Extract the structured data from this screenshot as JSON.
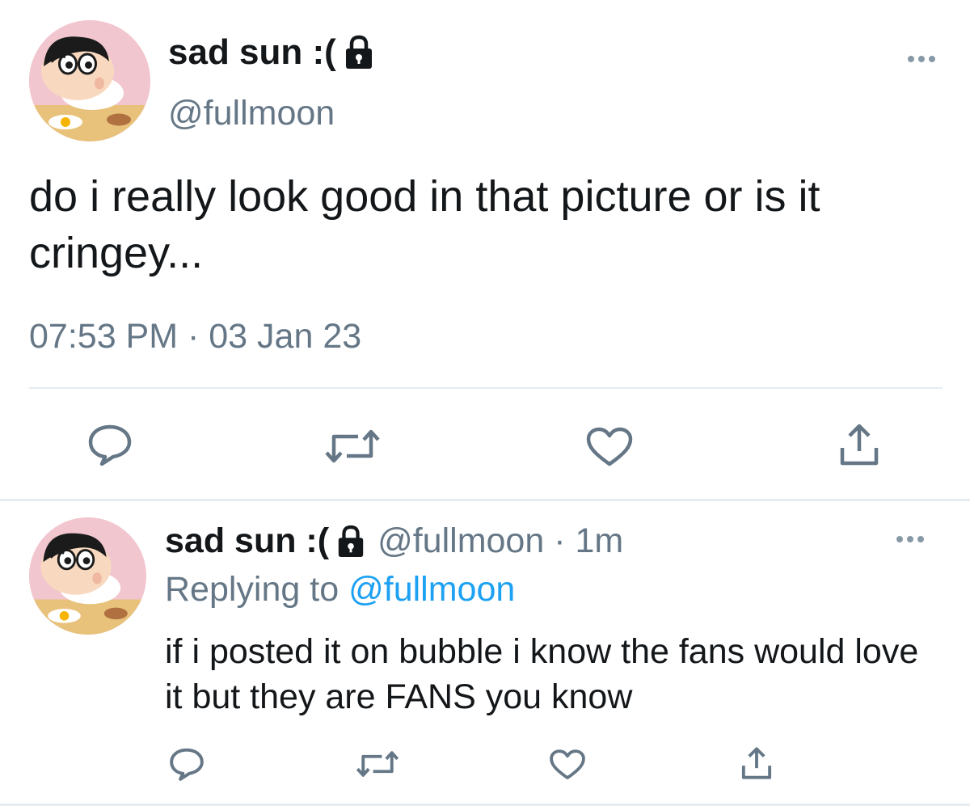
{
  "main_tweet": {
    "display_name": "sad sun :(",
    "handle": "@fullmoon",
    "text": "do i really look good in that picture or is it cringey...",
    "timestamp": "07:53 PM · 03 Jan 23",
    "icons": {
      "lock": "lock-icon",
      "more": "more-icon",
      "reply": "reply-icon",
      "retweet": "retweet-icon",
      "like": "like-icon",
      "share": "share-icon"
    }
  },
  "reply_tweet": {
    "display_name": "sad sun :(",
    "handle_time": "@fullmoon · 1m",
    "replying_prefix": "Replying to",
    "replying_mention": "@fullmoon",
    "text": "if i posted it on bubble i know the fans would love it but they are FANS you know"
  },
  "colors": {
    "text": "#14171a",
    "secondary": "#657786",
    "link": "#1da1f2",
    "icon": "#657786",
    "divider": "#e6ecf0"
  }
}
